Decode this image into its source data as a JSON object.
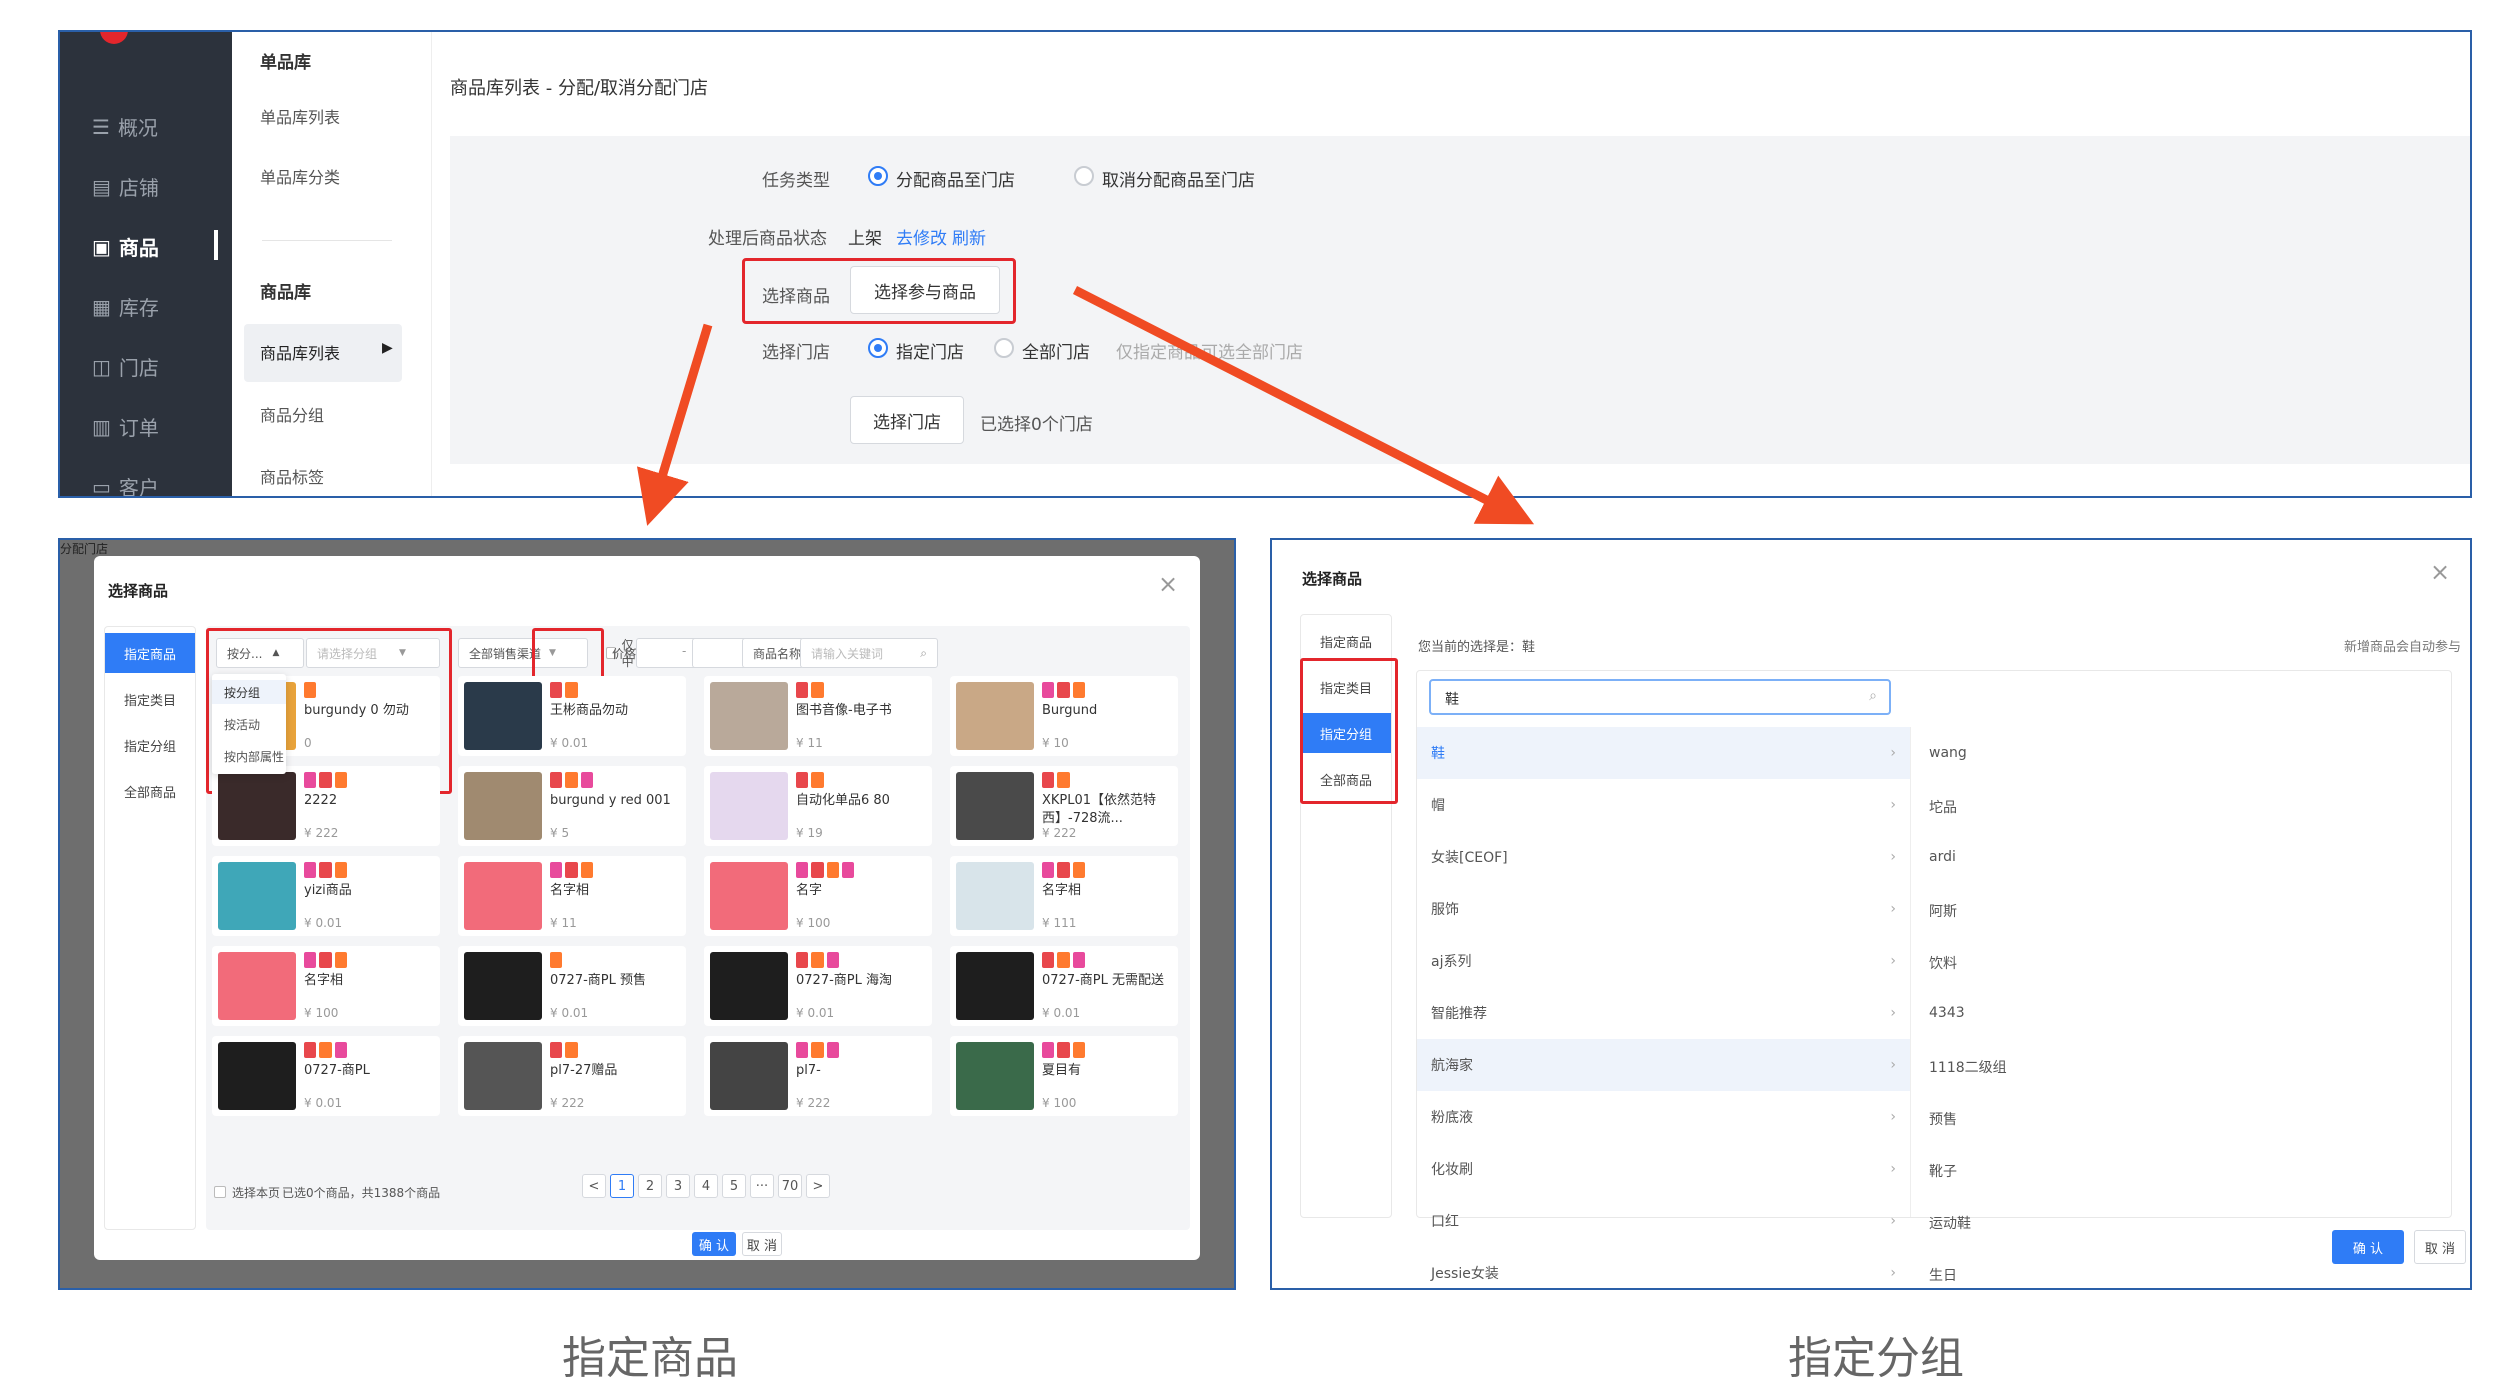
{
  "top": {
    "nav": [
      {
        "icon": "list-icon",
        "glyph": "☰",
        "label": "概况"
      },
      {
        "icon": "shop-icon",
        "glyph": "▤",
        "label": "店铺"
      },
      {
        "icon": "goods-icon",
        "glyph": "▣",
        "label": "商品"
      },
      {
        "icon": "stock-icon",
        "glyph": "▦",
        "label": "库存"
      },
      {
        "icon": "store-icon",
        "glyph": "◫",
        "label": "门店"
      },
      {
        "icon": "order-icon",
        "glyph": "▥",
        "label": "订单"
      },
      {
        "icon": "customer-icon",
        "glyph": "▭",
        "label": "客户"
      }
    ],
    "sub": {
      "h1": "单品库",
      "s1": "单品库列表",
      "s2": "单品库分类",
      "h2": "商品库",
      "s3": "商品库列表",
      "s4": "商品分组",
      "s5": "商品标签"
    },
    "crumb": "商品库列表 - 分配/取消分配门店",
    "task_label": "任务类型",
    "task_opt1": "分配商品至门店",
    "task_opt2": "取消分配商品至门店",
    "status_label": "处理后商品状态",
    "status_val": "上架",
    "status_edit": "去修改",
    "status_refresh": "刷新",
    "goods_label": "选择商品",
    "goods_btn": "选择参与商品",
    "store_label": "选择门店",
    "store_opt1": "指定门店",
    "store_opt2": "全部门店",
    "store_hint": "仅指定商品可选全部门店",
    "store_btn": "选择门店",
    "store_count": "已选择0个门店"
  },
  "left": {
    "bg_text": "分配门店",
    "title": "选择商品",
    "tabs": [
      "指定商品",
      "指定类目",
      "指定分组",
      "全部商品"
    ],
    "f_group": "按分...",
    "f_group_sel": "请选择分组",
    "f_channel": "全部销售渠道",
    "f_onshelf": "仅上架中",
    "f_price": "价格",
    "f_dash": "-",
    "f_name": "商品名称",
    "f_search": "请输入关键词",
    "drop": [
      "按分组",
      "按活动",
      "按内部属性"
    ],
    "cards": [
      {
        "name": "burgundy 0 勿动",
        "price": "0",
        "img": "#e8a33b",
        "tags": [
          "#ff7a2f"
        ]
      },
      {
        "name": "王彬商品勿动",
        "price": "¥ 0.01",
        "img": "#2a3a4a",
        "tags": [
          "#e8474c",
          "#ff7a2f"
        ]
      },
      {
        "name": "图书音像-电子书",
        "price": "¥ 11",
        "img": "#b9a99a",
        "tags": [
          "#e8474c",
          "#ff7a2f"
        ]
      },
      {
        "name": "Burgund",
        "price": "¥ 10",
        "img": "#c9a886",
        "tags": [
          "#e84a9c",
          "#e8474c",
          "#ff7a2f"
        ]
      },
      {
        "name": "2222",
        "price": "¥ 222",
        "img": "#3a2a2a",
        "tags": [
          "#e84a9c",
          "#e8474c",
          "#ff7a2f"
        ]
      },
      {
        "name": "burgund y red 001",
        "price": "¥ 5",
        "img": "#a08a70",
        "tags": [
          "#e8474c",
          "#ff7a2f",
          "#e84a9c"
        ]
      },
      {
        "name": "自动化单品6 80",
        "price": "¥ 19",
        "img": "#e5d8ee",
        "tags": [
          "#e8474c",
          "#ff7a2f"
        ]
      },
      {
        "name": "XKPL01【依然范特西】-728流...",
        "price": "¥ 222",
        "img": "#4a4a4a",
        "tags": [
          "#e8474c",
          "#ff7a2f"
        ]
      },
      {
        "name": "yizi商品",
        "price": "¥ 0.01",
        "img": "#3fa7b8",
        "tags": [
          "#e84a9c",
          "#e8474c",
          "#ff7a2f"
        ]
      },
      {
        "name": "名字相",
        "price": "¥ 11",
        "img": "#f26b7a",
        "tags": [
          "#e84a9c",
          "#e8474c",
          "#ff7a2f"
        ]
      },
      {
        "name": "名字",
        "price": "¥ 100",
        "img": "#f26b7a",
        "tags": [
          "#e84a9c",
          "#e8474c",
          "#ff7a2f",
          "#e84a9c"
        ]
      },
      {
        "name": "名字相",
        "price": "¥ 111",
        "img": "#d8e4ea",
        "tags": [
          "#e84a9c",
          "#e8474c",
          "#ff7a2f"
        ]
      },
      {
        "name": "名字相",
        "price": "¥ 100",
        "img": "#f26b7a",
        "tags": [
          "#e84a9c",
          "#e8474c",
          "#ff7a2f"
        ]
      },
      {
        "name": "0727-商PL 预售",
        "price": "¥ 0.01",
        "img": "#1e1e1e",
        "tags": [
          "#ff7a2f"
        ]
      },
      {
        "name": "0727-商PL 海淘",
        "price": "¥ 0.01",
        "img": "#1e1e1e",
        "tags": [
          "#e8474c",
          "#ff7a2f",
          "#e84a9c"
        ]
      },
      {
        "name": "0727-商PL 无需配送",
        "price": "¥ 0.01",
        "img": "#1e1e1e",
        "tags": [
          "#e8474c",
          "#ff7a2f",
          "#e84a9c"
        ]
      },
      {
        "name": "0727-商PL",
        "price": "¥ 0.01",
        "img": "#1e1e1e",
        "tags": [
          "#e8474c",
          "#ff7a2f",
          "#e84a9c"
        ]
      },
      {
        "name": "pl7-27赠品",
        "price": "¥ 222",
        "img": "#555",
        "tags": [
          "#e8474c",
          "#ff7a2f"
        ]
      },
      {
        "name": "pl7-",
        "price": "¥ 222",
        "img": "#444",
        "tags": [
          "#e84a9c",
          "#ff7a2f",
          "#e84a9c"
        ]
      },
      {
        "name": "夏目有",
        "price": "¥ 100",
        "img": "#3a6a4a",
        "tags": [
          "#e84a9c",
          "#e8474c",
          "#ff7a2f"
        ]
      }
    ],
    "select_page": "选择本页",
    "summary": "已选0个商品，共1388个商品",
    "pages": [
      "<",
      "1",
      "2",
      "3",
      "4",
      "5",
      "···",
      "70",
      ">"
    ],
    "ok": "确 认",
    "cancel": "取 消"
  },
  "right": {
    "title": "选择商品",
    "tabs": [
      "指定商品",
      "指定类目",
      "指定分组",
      "全部商品"
    ],
    "current_label": "您当前的选择是：鞋",
    "hint": "新增商品会自动参与",
    "search_val": "鞋",
    "groups": [
      "鞋",
      "帽",
      "女装[CEOF]",
      "服饰",
      "aj系列",
      "智能推荐",
      "航海家",
      "粉底液",
      "化妆刷",
      "口红",
      "Jessie女装"
    ],
    "values": [
      "wang",
      "坨品",
      "ardi",
      "阿斯",
      "饮料",
      "4343",
      "1118二级组",
      "预售",
      "靴子",
      "运动鞋",
      "生日"
    ],
    "ok": "确 认",
    "cancel": "取 消"
  },
  "captions": {
    "left": "指定商品",
    "right": "指定分组"
  }
}
